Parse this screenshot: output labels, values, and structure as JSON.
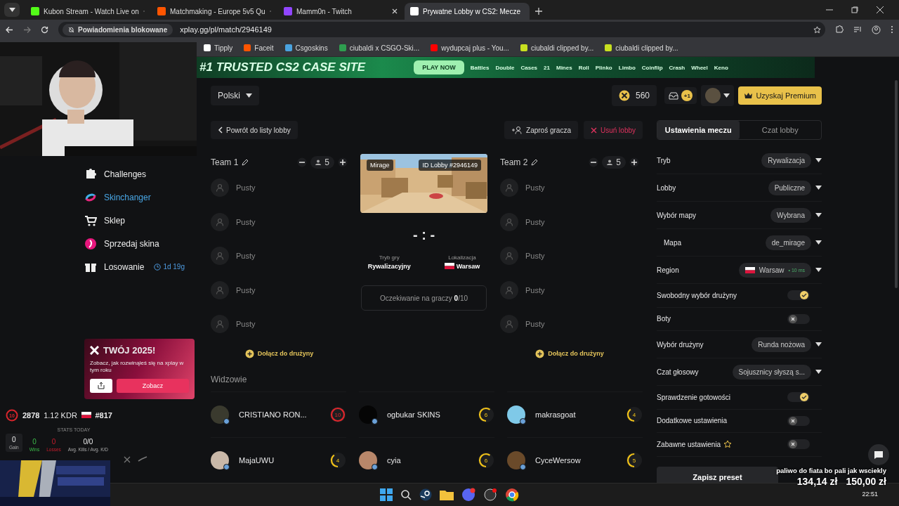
{
  "browser": {
    "tabs": [
      {
        "title": "Kubon Stream - Watch Live on",
        "selected": false,
        "color": "#53fc18"
      },
      {
        "title": "Matchmaking - Europe 5v5 Qu",
        "selected": false,
        "color": "#ff5500"
      },
      {
        "title": "Mamm0n - Twitch",
        "selected": false,
        "color": "#9146ff"
      },
      {
        "title": "Prywatne Lobby w CS2: Mecze",
        "selected": true,
        "color": "#ffffff"
      }
    ],
    "notice": "Powiadomienia blokowane",
    "url": "xplay.gg/pl/match/2946149",
    "bookmarks": [
      {
        "label": "Tipply",
        "color": "#ffffff"
      },
      {
        "label": "Faceit",
        "color": "#ff5500"
      },
      {
        "label": "Csgoskins",
        "color": "#4aa3df"
      },
      {
        "label": "ciubaldi x CSGO-Ski...",
        "color": "#2e9e4f"
      },
      {
        "label": "wydupcaj plus - You...",
        "color": "#ff0000"
      },
      {
        "label": "ciubaldi clipped by...",
        "color": "#c8e020"
      },
      {
        "label": "ciubaldi clipped by...",
        "color": "#c8e020"
      }
    ]
  },
  "banner": {
    "headline": "#1 TRUSTED CS2 CASE SITE",
    "button": "PLAY NOW",
    "links": [
      "Battles",
      "Double",
      "Cases",
      "21",
      "Mines",
      "Roll",
      "Plinko",
      "Limbo",
      "Coinflip",
      "Crash",
      "Wheel",
      "Keno"
    ]
  },
  "sidebar": {
    "items": [
      {
        "label": "Challenges",
        "kind": "puzzle",
        "highlighted": false
      },
      {
        "label": "Skinchanger",
        "kind": "swirl",
        "highlighted": true
      },
      {
        "label": "Sklep",
        "kind": "cart",
        "highlighted": false
      },
      {
        "label": "Sprzedaj skina",
        "kind": "sell",
        "highlighted": false
      },
      {
        "label": "Losowanie",
        "kind": "gift",
        "highlighted": false,
        "timer": "1d 19g"
      }
    ]
  },
  "promo": {
    "title": "TWÓJ 2025!",
    "text": "Zobacz, jak rozwinąłeś się na xplay w tym roku",
    "button": "Zobacz"
  },
  "stats": {
    "level": "10",
    "elo": "2878",
    "kdr": "1.12 KDR",
    "rank": "#817",
    "today_label": "STATS TODAY",
    "items": [
      {
        "value": "0",
        "label": "Gain",
        "kind": "box"
      },
      {
        "value": "0",
        "label": "Wins",
        "kind": "win"
      },
      {
        "value": "0",
        "label": "Losses",
        "kind": "loss"
      },
      {
        "value": "0/0",
        "label": "Avg. Kills / Avg. K/D",
        "kind": "plain"
      }
    ]
  },
  "header": {
    "language": "Polski",
    "coins": "560",
    "messages_badge": "+1",
    "premium_button": "Uzyskaj Premium"
  },
  "lobby": {
    "back_button": "Powrót do listy lobby",
    "invite_button": "Zaproś gracza",
    "delete_button": "Usuń lobby",
    "teams": [
      {
        "name": "Team 1",
        "size": "5",
        "slots": [
          "Pusty",
          "Pusty",
          "Pusty",
          "Pusty",
          "Pusty"
        ],
        "join_button": "Dołącz do drużyny"
      },
      {
        "name": "Team 2",
        "size": "5",
        "slots": [
          "Pusty",
          "Pusty",
          "Pusty",
          "Pusty",
          "Pusty"
        ],
        "join_button": "Dołącz do drużyny"
      }
    ],
    "map": {
      "name": "Mirage",
      "lobby_id": "ID Lobby #2946149"
    },
    "score": "- : -",
    "mode_label": "Tryb gry",
    "mode": "Rywalizacyjny",
    "location_label": "Lokalizacja",
    "location": "Warsaw",
    "waiting": "Oczekiwanie na graczy **0**/10"
  },
  "spectators": {
    "title": "Widzowie",
    "items": [
      {
        "name": "CRISTIANO RON...",
        "level": "10",
        "color": "#e0262c"
      },
      {
        "name": "ogbukar SKINS",
        "level": "6",
        "color": "#f2c318"
      },
      {
        "name": "makrasgoat",
        "level": "4",
        "color": "#f2c318"
      },
      {
        "name": "MajaUWU",
        "level": "4",
        "color": "#f2c318"
      },
      {
        "name": "cyia",
        "level": "6",
        "color": "#f2c318"
      },
      {
        "name": "CyceWersow",
        "level": "5",
        "color": "#f2c318"
      }
    ]
  },
  "settings": {
    "tabs": [
      {
        "label": "Ustawienia meczu",
        "selected": true
      },
      {
        "label": "Czat lobby",
        "selected": false
      }
    ],
    "rows": [
      {
        "kind": "select",
        "label": "Tryb",
        "value": "Rywalizacja"
      },
      {
        "kind": "select",
        "label": "Lobby",
        "value": "Publiczne"
      },
      {
        "kind": "select",
        "label": "Wybór mapy",
        "value": "Wybrana",
        "children": [
          {
            "kind": "select",
            "label": "Mapa",
            "value": "de_mirage"
          }
        ]
      },
      {
        "kind": "region",
        "label": "Region",
        "value": "Warsaw",
        "latency": "• 10 ms"
      },
      {
        "kind": "toggle",
        "label": "Swobodny wybór drużyny",
        "on": true
      },
      {
        "kind": "toggle",
        "label": "Boty",
        "on": false
      },
      {
        "kind": "select",
        "label": "Wybór drużyny",
        "value": "Runda nożowa"
      },
      {
        "kind": "select",
        "label": "Czat głosowy",
        "value": "Sojusznicy słyszą s..."
      },
      {
        "kind": "toggle",
        "label": "Sprawdzenie gotowości",
        "on": true
      },
      {
        "kind": "toggle",
        "label": "Dodatkowe ustawienia",
        "on": false
      },
      {
        "kind": "startoggle",
        "label": "Zabawne ustawienia",
        "on": false
      }
    ],
    "save_button": "Zapisz preset"
  },
  "overlay": {
    "caption": "paliwo do fiata bo pali jak wsciekly",
    "amounts": [
      "134,14 zł",
      "150,00 zł"
    ]
  },
  "taskbar": {
    "clock": "22:51"
  }
}
